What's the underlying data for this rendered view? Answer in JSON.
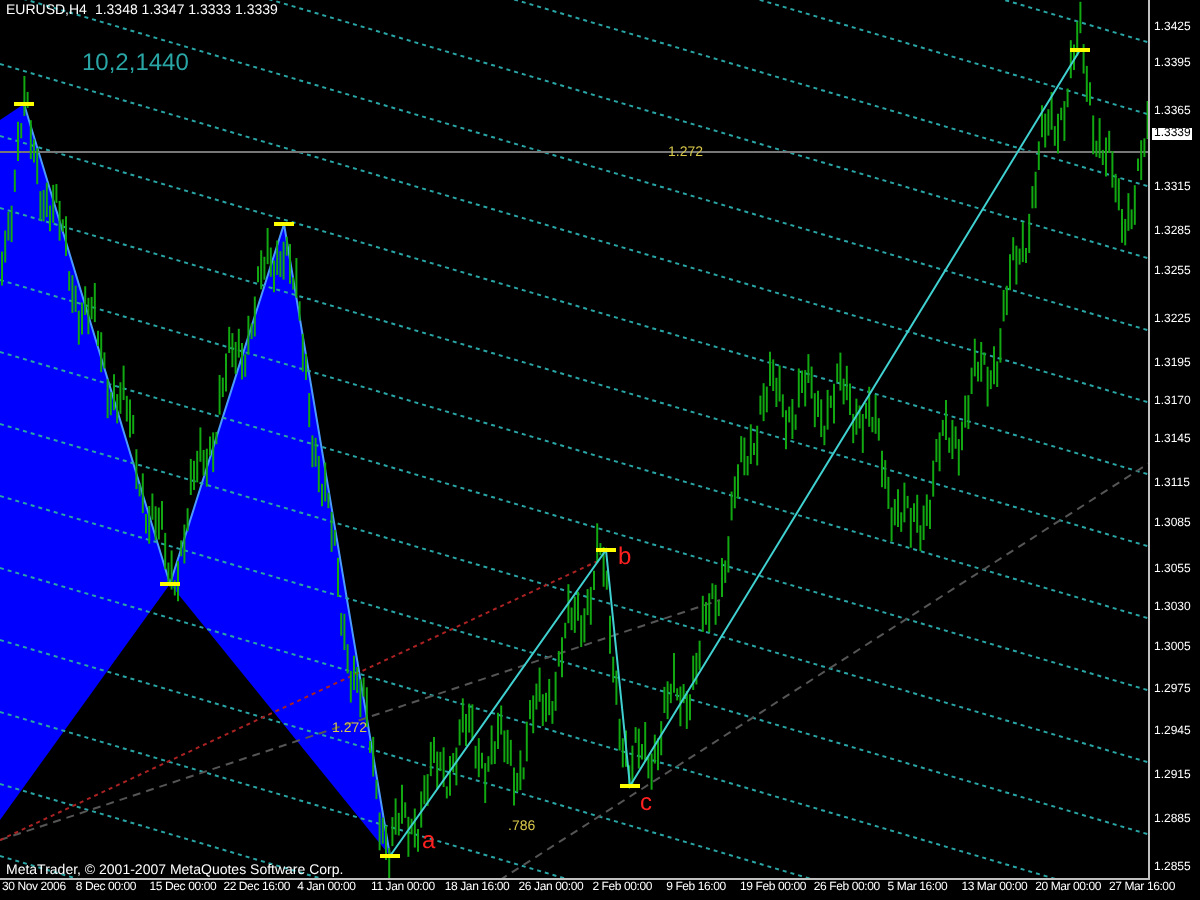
{
  "header": {
    "symbol": "EURUSD,H4",
    "quotes": "1.3348 1.3347 1.3333 1.3339"
  },
  "indicator_params": "10,2,1440",
  "chart_labels": [
    {
      "text": "a",
      "kind": "point"
    },
    {
      "text": "b",
      "kind": "point"
    },
    {
      "text": "c",
      "kind": "point"
    },
    {
      "text": "1.272",
      "kind": "level"
    },
    {
      "text": "1.272",
      "kind": "level"
    },
    {
      "text": ".786",
      "kind": "level"
    }
  ],
  "copyright": "MetaTrader, © 2001-2007 MetaQuotes Software Corp.",
  "price_axis": {
    "ticks": [
      "1.3425",
      "1.3395",
      "1.3365",
      "1.3315",
      "1.3285",
      "1.3255",
      "1.3225",
      "1.3195",
      "1.3170",
      "1.3145",
      "1.3115",
      "1.3085",
      "1.3055",
      "1.3030",
      "1.3005",
      "1.2975",
      "1.2945",
      "1.2915",
      "1.2885",
      "1.2855"
    ],
    "current_price": "1.3339"
  },
  "time_axis": [
    "30 Nov 2006",
    "8 Dec 00:00",
    "15 Dec 00:00",
    "22 Dec 16:00",
    "4 Jan 00:00",
    "11 Jan 00:00",
    "18 Jan 16:00",
    "26 Jan 00:00",
    "2 Feb 00:00",
    "9 Feb 16:00",
    "19 Feb 00:00",
    "26 Feb 00:00",
    "5 Mar 16:00",
    "13 Mar 00:00",
    "20 Mar 00:00",
    "27 Mar 16:00"
  ]
}
